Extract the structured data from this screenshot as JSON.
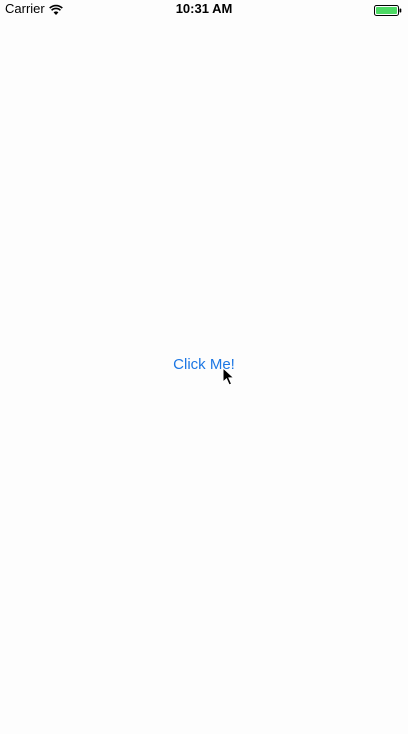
{
  "status_bar": {
    "carrier": "Carrier",
    "time": "10:31 AM",
    "wifi_icon": "wifi-icon",
    "battery_icon": "battery-icon",
    "battery_color": "#4cd964"
  },
  "main": {
    "button_label": "Click Me!",
    "button_color": "#1c77e4"
  },
  "cursor": {
    "icon": "arrow-cursor-icon"
  }
}
